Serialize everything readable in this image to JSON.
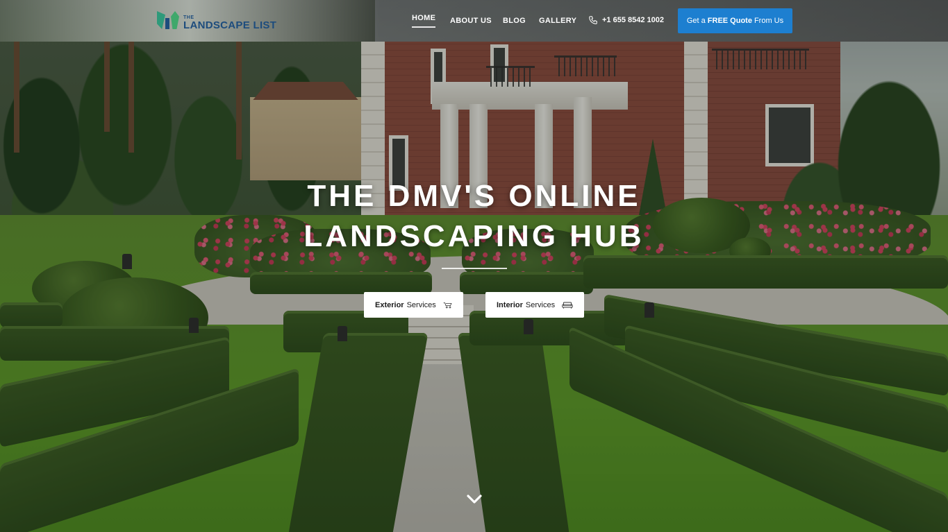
{
  "brand": {
    "logo_the": "THE",
    "logo_name": "LANDSCAPE LIST"
  },
  "nav": {
    "home": "HOME",
    "about": "ABOUT US",
    "blog": "BLOG",
    "gallery": "GALLERY",
    "active": "HOME"
  },
  "contact": {
    "phone": "+1 655 8542 1002"
  },
  "quote_button": {
    "prefix": "Get a",
    "bold": "FREE Quote",
    "suffix": "From Us",
    "color": "#1d7fd0"
  },
  "hero": {
    "headline_line1": "THE DMV'S ONLINE",
    "headline_line2": "LANDSCAPING HUB"
  },
  "services": {
    "exterior": {
      "bold": "Exterior",
      "rest": "Services",
      "icon": "wheelbarrow-icon"
    },
    "interior": {
      "bold": "Interior",
      "rest": "Services",
      "icon": "sofa-icon"
    }
  },
  "icons": {
    "phone": "phone-icon",
    "scroll": "chevron-down-icon"
  }
}
